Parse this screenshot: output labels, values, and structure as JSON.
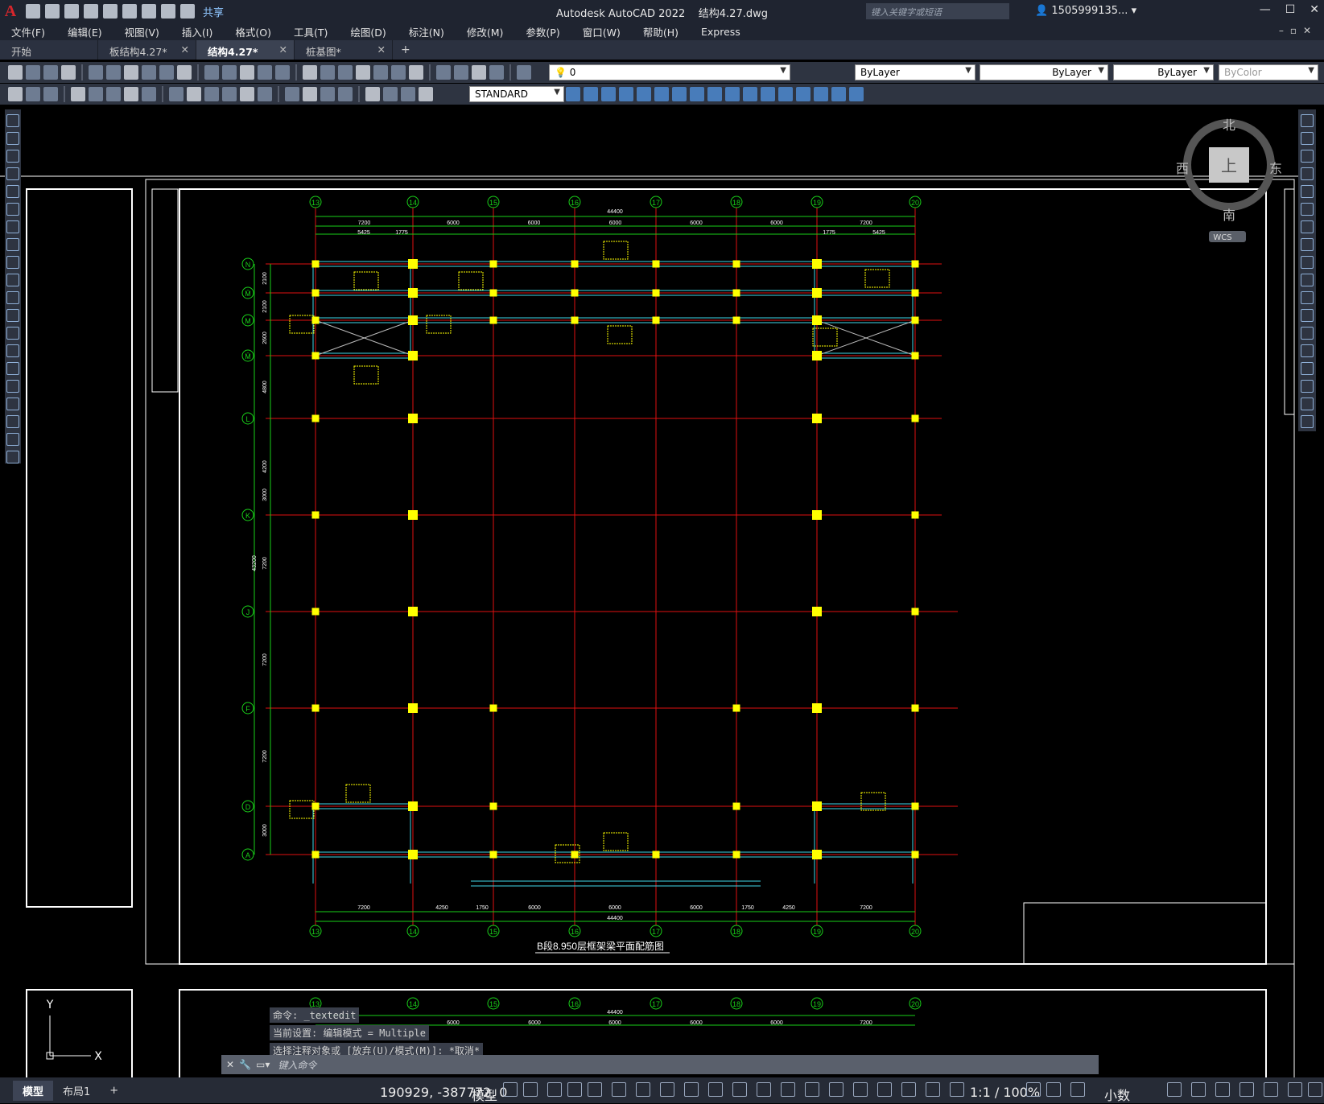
{
  "app": {
    "title": "Autodesk AutoCAD 2022",
    "file": "结构4.27.dwg",
    "share": "共享",
    "search_placeholder": "键入关键字或短语",
    "user": "1505999135...",
    "help": "?"
  },
  "menu": [
    "文件(F)",
    "编辑(E)",
    "视图(V)",
    "插入(I)",
    "格式(O)",
    "工具(T)",
    "绘图(D)",
    "标注(N)",
    "修改(M)",
    "参数(P)",
    "窗口(W)",
    "帮助(H)",
    "Express"
  ],
  "tabs": [
    {
      "label": "开始",
      "close": ""
    },
    {
      "label": "板结构4.27*",
      "close": "✕"
    },
    {
      "label": "结构4.27*",
      "close": "✕"
    },
    {
      "label": "桩基图*",
      "close": "✕"
    }
  ],
  "props": {
    "layer": "0",
    "color": "ByLayer",
    "linetype": "ByLayer",
    "lineweight": "ByLayer",
    "plotstyle": "ByColor",
    "textstyle": "STANDARD"
  },
  "viewcube": {
    "n": "北",
    "s": "南",
    "e": "东",
    "w": "西",
    "top": "上",
    "wcs": "WCS"
  },
  "drawing": {
    "title": "B段8.950层框架梁平面配筋图",
    "col_axes": [
      "13",
      "14",
      "15",
      "16",
      "17",
      "18",
      "19",
      "20"
    ],
    "row_axes": [
      "N",
      "M",
      "M",
      "M",
      "L",
      "K",
      "J",
      "F",
      "D",
      "A"
    ],
    "row_axes_display": [
      "N",
      "M̄",
      "M",
      "M̄",
      "L",
      "K",
      "J",
      "F",
      "D",
      "A"
    ],
    "top_dims": [
      "7200",
      "6000",
      "6000",
      "6000",
      "6000",
      "6000",
      "7200"
    ],
    "top_sub_dims": [
      "5425",
      "1775",
      "1775",
      "5425"
    ],
    "total": "44400",
    "bottom_dims": [
      "7200",
      "4250",
      "1750",
      "6000",
      "6000",
      "6000",
      "1750",
      "4250",
      "7200"
    ],
    "left_dims": [
      "2100",
      "2100",
      "2600",
      "4800",
      "4200",
      "3000",
      "7200",
      "7200",
      "7200",
      "3000"
    ],
    "left_total": "43200",
    "lower_top_dims": [
      "6000",
      "6000",
      "6000",
      "6000",
      "6000",
      "7200"
    ]
  },
  "command": {
    "history": [
      "命令: _textedit",
      "当前设置: 编辑模式 = Multiple",
      "选择注释对象或 [放弃(U)/模式(M)]: *取消*"
    ],
    "placeholder": "键入命令"
  },
  "status": {
    "layouts": [
      "模型",
      "布局1"
    ],
    "coords": "190929, -387772, 0",
    "model": "模型",
    "scale": "1:1 / 100%",
    "units": "小数"
  }
}
